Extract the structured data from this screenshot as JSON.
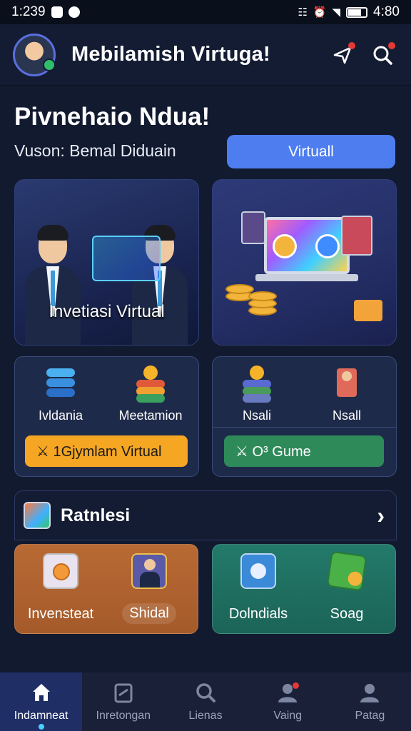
{
  "status_bar": {
    "time": "1:239",
    "clock": "4:80"
  },
  "app_bar": {
    "title": "Mebilamish Virtuga!"
  },
  "header": {
    "title": "Pivnehaio Ndua!",
    "subtitle": "Vuson: Bemal Diduain",
    "button_label": "Virtuall"
  },
  "hero_cards": [
    {
      "label": "Invetiasi Virtual"
    },
    {
      "label": ""
    }
  ],
  "panel_left": {
    "items": [
      {
        "label": "Ivldania",
        "icon": "stack-icon"
      },
      {
        "label": "Meetamion",
        "icon": "sun-stack-icon"
      }
    ],
    "action_label": "⚔ 1Gjymlam Virtual"
  },
  "panel_right": {
    "items": [
      {
        "label": "Nsali",
        "icon": "sun-stack-icon"
      },
      {
        "label": "Nsall",
        "icon": "person-card-icon"
      }
    ],
    "action_label": "⚔ O³ Gume"
  },
  "section": {
    "title": "Ratnlesi"
  },
  "tiles": [
    {
      "items": [
        {
          "label": "Invensteat",
          "icon": "coin-card-icon"
        },
        {
          "label": "Shidal",
          "icon": "person-card-icon"
        }
      ]
    },
    {
      "items": [
        {
          "label": "Dolndials",
          "icon": "document-icon"
        },
        {
          "label": "Soag",
          "icon": "cube-icon"
        }
      ]
    }
  ],
  "tabs": [
    {
      "label": "Indamneat",
      "icon": "home-icon",
      "active": true
    },
    {
      "label": "Inretongan",
      "icon": "clipboard-icon"
    },
    {
      "label": "Lienas",
      "icon": "search-icon"
    },
    {
      "label": "Vaing",
      "icon": "user-icon"
    },
    {
      "label": "Patag",
      "icon": "profile-icon"
    }
  ],
  "colors": {
    "background": "#121a30",
    "primary": "#4e7df0",
    "orange": "#f5a623",
    "green": "#2e8a58",
    "tile_orange": "#b86a34",
    "tile_teal": "#237a6a"
  }
}
